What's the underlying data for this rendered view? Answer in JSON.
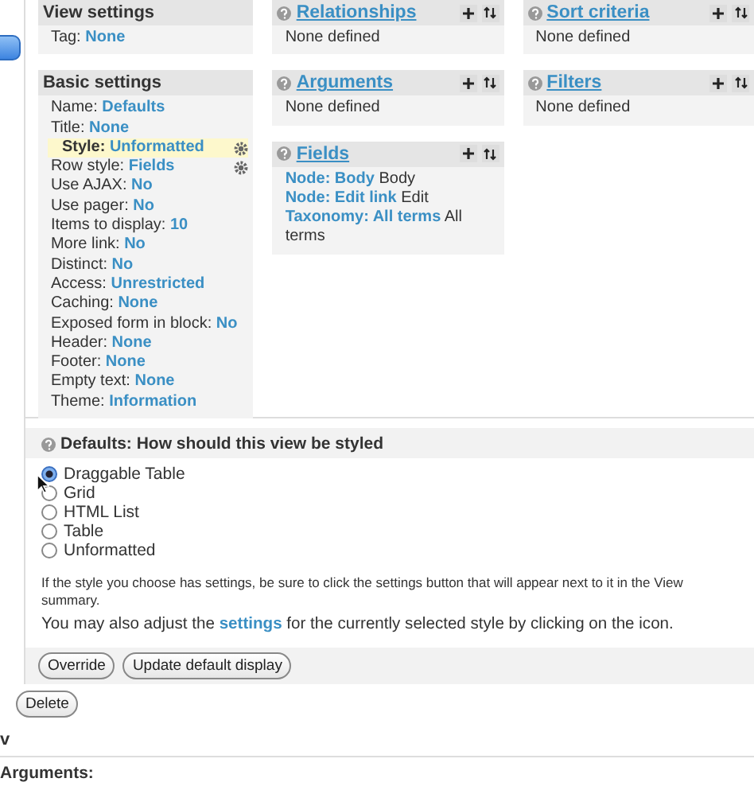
{
  "settings_column": [
    {
      "title": "View settings",
      "items": [
        {
          "label": "Tag:",
          "value": "None",
          "highlighted": false,
          "settings_button": false
        }
      ]
    },
    {
      "title": "Basic settings",
      "items": [
        {
          "label": "Name:",
          "value": "Defaults",
          "highlighted": false,
          "settings_button": false
        },
        {
          "label": "Title:",
          "value": "None",
          "highlighted": false,
          "settings_button": false
        },
        {
          "label": "Style:",
          "value": "Unformatted",
          "highlighted": true,
          "settings_button": true
        },
        {
          "label": "Row style:",
          "value": "Fields",
          "highlighted": false,
          "settings_button": true
        },
        {
          "label": "Use AJAX:",
          "value": "No",
          "highlighted": false,
          "settings_button": false
        },
        {
          "label": "Use pager:",
          "value": "No",
          "highlighted": false,
          "settings_button": false
        },
        {
          "label": "Items to display:",
          "value": "10",
          "highlighted": false,
          "settings_button": false
        },
        {
          "label": "More link:",
          "value": "No",
          "highlighted": false,
          "settings_button": false
        },
        {
          "label": "Distinct:",
          "value": "No",
          "highlighted": false,
          "settings_button": false
        },
        {
          "label": "Access:",
          "value": "Unrestricted",
          "highlighted": false,
          "settings_button": false
        },
        {
          "label": "Caching:",
          "value": "None",
          "highlighted": false,
          "settings_button": false
        },
        {
          "label": "Exposed form in block:",
          "value": "No",
          "highlighted": false,
          "settings_button": false
        },
        {
          "label": "Header:",
          "value": "None",
          "highlighted": false,
          "settings_button": false
        },
        {
          "label": "Footer:",
          "value": "None",
          "highlighted": false,
          "settings_button": false
        },
        {
          "label": "Empty text:",
          "value": "None",
          "highlighted": false,
          "settings_button": false
        },
        {
          "label": "Theme:",
          "value": "Information",
          "highlighted": false,
          "settings_button": false
        }
      ]
    }
  ],
  "section_columns": [
    [
      {
        "title": "Relationships",
        "entries": [
          {
            "text": "None defined"
          }
        ]
      },
      {
        "title": "Arguments",
        "entries": [
          {
            "text": "None defined"
          }
        ]
      },
      {
        "title": "Fields",
        "entries": [
          {
            "link": "Node: Body",
            "text": "Body"
          },
          {
            "link": "Node: Edit link",
            "text": "Edit"
          },
          {
            "link": "Taxonomy: All terms",
            "text": "All terms"
          }
        ]
      }
    ],
    [
      {
        "title": "Sort criteria",
        "entries": [
          {
            "text": "None defined"
          }
        ]
      },
      {
        "title": "Filters",
        "entries": [
          {
            "text": "None defined"
          }
        ]
      }
    ]
  ],
  "style_form": {
    "title": "Defaults: How should this view be styled",
    "options": [
      {
        "label": "Draggable Table",
        "selected": true
      },
      {
        "label": "Grid",
        "selected": false
      },
      {
        "label": "HTML List",
        "selected": false
      },
      {
        "label": "Table",
        "selected": false
      },
      {
        "label": "Unformatted",
        "selected": false
      }
    ],
    "note": "If the style you choose has settings, be sure to click the settings button that will appear next to it in the View summary.",
    "hint": {
      "before": "You may also adjust the ",
      "link": "settings",
      "after": " for the currently selected style by clicking on the icon."
    },
    "buttons": [
      "Override",
      "Update default display"
    ]
  },
  "delete_button": "Delete",
  "heading": "v",
  "arguments_label": "Arguments:"
}
